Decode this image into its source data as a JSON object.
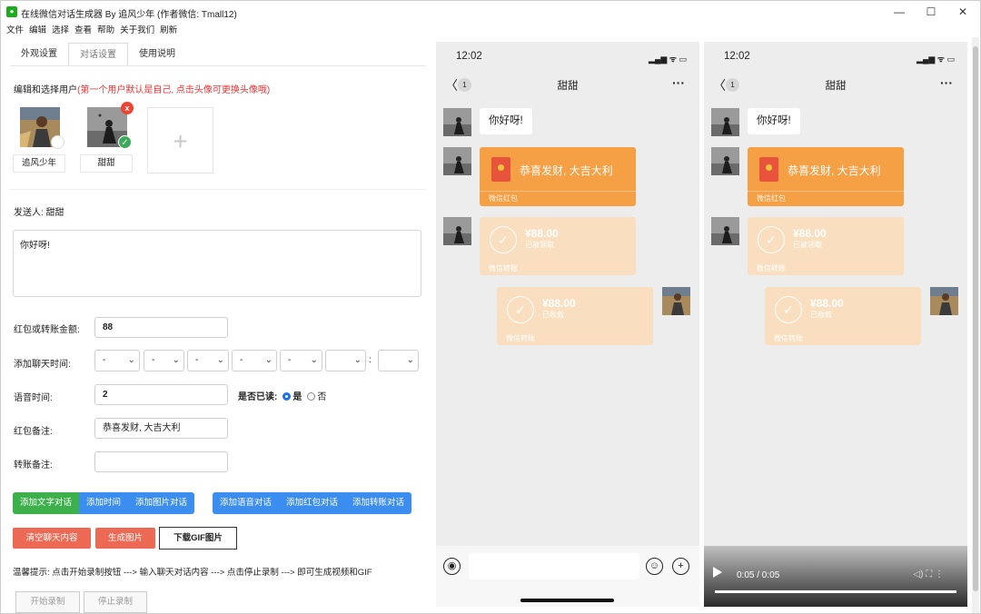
{
  "window": {
    "title": "在线微信对话生成器 By 追风少年 (作者微信: Tmall12)",
    "minimize": "—",
    "maximize": "☐",
    "close": "✕"
  },
  "menu": [
    "文件",
    "编辑",
    "选择",
    "查看",
    "帮助",
    "关于我们",
    "刷新"
  ],
  "tabs": [
    "外观设置",
    "对话设置",
    "使用说明"
  ],
  "users_hint": {
    "prefix": "编辑和选择用户",
    "note": "(第一个用户默认是自己, 点击头像可更换头像哦)"
  },
  "users": [
    {
      "name": "追风少年"
    },
    {
      "name": "甜甜"
    }
  ],
  "add_user": "+",
  "delete_mark": "x",
  "sender": "发送人: 甜甜",
  "message_text": "你好呀!",
  "form": {
    "amount_label": "红包或转账金额:",
    "amount_value": "88",
    "time_label": "添加聊天时间:",
    "time_selects": [
      "-",
      "-",
      "-",
      "-",
      "-",
      "",
      ""
    ],
    "time_colon": ":",
    "voice_label": "语音时间:",
    "voice_value": "2",
    "read_label": "是否已读:",
    "read_yes": "是",
    "read_no": "否",
    "hb_note_label": "红包备注:",
    "hb_note_value": "恭喜发财, 大吉大利",
    "transfer_note_label": "转账备注:",
    "transfer_note_value": ""
  },
  "buttons": {
    "add_text": "添加文字对话",
    "add_time": "添加时间",
    "add_image": "添加图片对话",
    "add_voice": "添加语音对话",
    "add_hongbao": "添加红包对话",
    "add_transfer": "添加转账对话",
    "clear": "清空聊天内容",
    "gen_image": "生成图片",
    "download_gif": "下载GIF图片",
    "start_rec": "开始录制",
    "stop_rec": "停止录制"
  },
  "tip": "温馨提示: 点击开始录制按钮 ---> 输入聊天对话内容 ---> 点击停止录制 ---> 即可生成视频和GIF",
  "phone": {
    "time": "12:02",
    "status": "▂▄▆ ᯤ ▭",
    "back": "〈",
    "unread": "1",
    "contact": "甜甜",
    "more": "···",
    "msg_text": "你好呀!",
    "hongbao_text": "恭喜发财, 大吉大利",
    "hongbao_label": "微信红包",
    "transfer_amount": "¥88.00",
    "transfer_status_received": "已被领取",
    "transfer_status_collected": "已收款",
    "transfer_label": "微信转账",
    "voice_icon": "◉",
    "emoji_icon": "☺",
    "plus_icon": "+"
  },
  "video": {
    "time": "0:05 / 0:05"
  },
  "colors": {
    "green": "#3db04b",
    "blue": "#3b8df0",
    "red_btn": "#ec6a54",
    "hongbao": "#f6a045",
    "transfer": "#f9dfbf"
  }
}
